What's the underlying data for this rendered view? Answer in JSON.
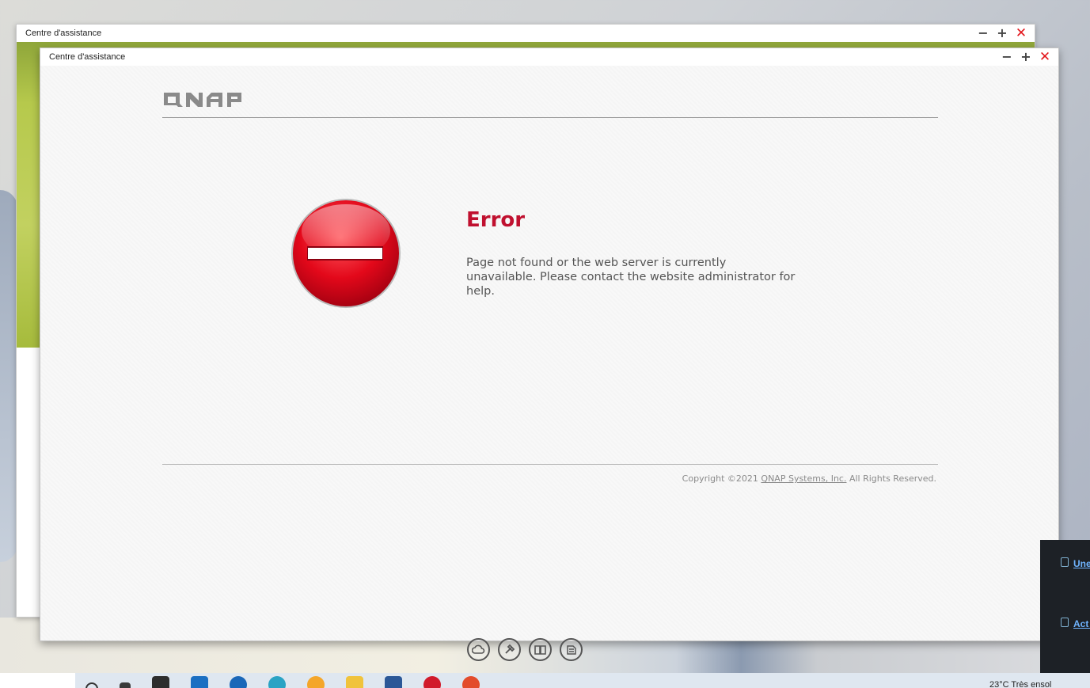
{
  "back_window": {
    "title": "Centre d'assistance"
  },
  "front_window": {
    "title": "Centre d'assistance"
  },
  "controls": {
    "minimize": "−",
    "maximize": "+",
    "close": "✕"
  },
  "page": {
    "logo_text": "QNAP",
    "error_title": "Error",
    "error_message": "Page not found or the web server is currently unavailable. Please contact the website administrator for help.",
    "copyright_prefix": "Copyright ©2021 ",
    "copyright_link": "QNAP Systems, Inc.",
    "copyright_suffix": " All Rights Reserved."
  },
  "dock": {
    "icons": [
      "cloud-icon",
      "tools-icon",
      "book-icon",
      "notes-icon"
    ]
  },
  "notifications": {
    "items": [
      "Une dis",
      "Act ajo cor"
    ]
  },
  "taskbar": {
    "weather_text": "23°C  Très ensol"
  },
  "colors": {
    "error_red": "#c0102f",
    "close_red": "#e3161c",
    "accent_green": "#b6c94c"
  }
}
